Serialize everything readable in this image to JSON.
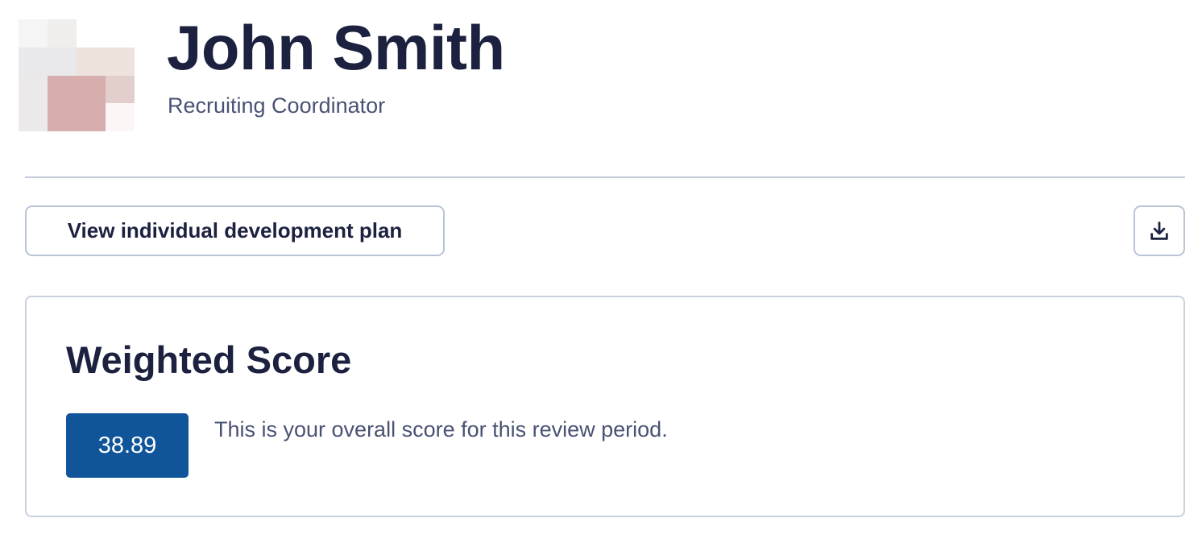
{
  "profile": {
    "name": "John Smith",
    "role": "Recruiting Coordinator",
    "avatar_icon": "avatar-placeholder-icon"
  },
  "actions": {
    "idp_button_label": "View individual development plan",
    "download_icon": "download-icon"
  },
  "weighted_score": {
    "title": "Weighted Score",
    "value": "38.89",
    "description": "This is your overall score for this review period."
  },
  "colors": {
    "text_primary": "#1c2140",
    "text_secondary": "#4a5274",
    "border": "#b9c4d6",
    "score_badge_bg": "#10549a"
  }
}
